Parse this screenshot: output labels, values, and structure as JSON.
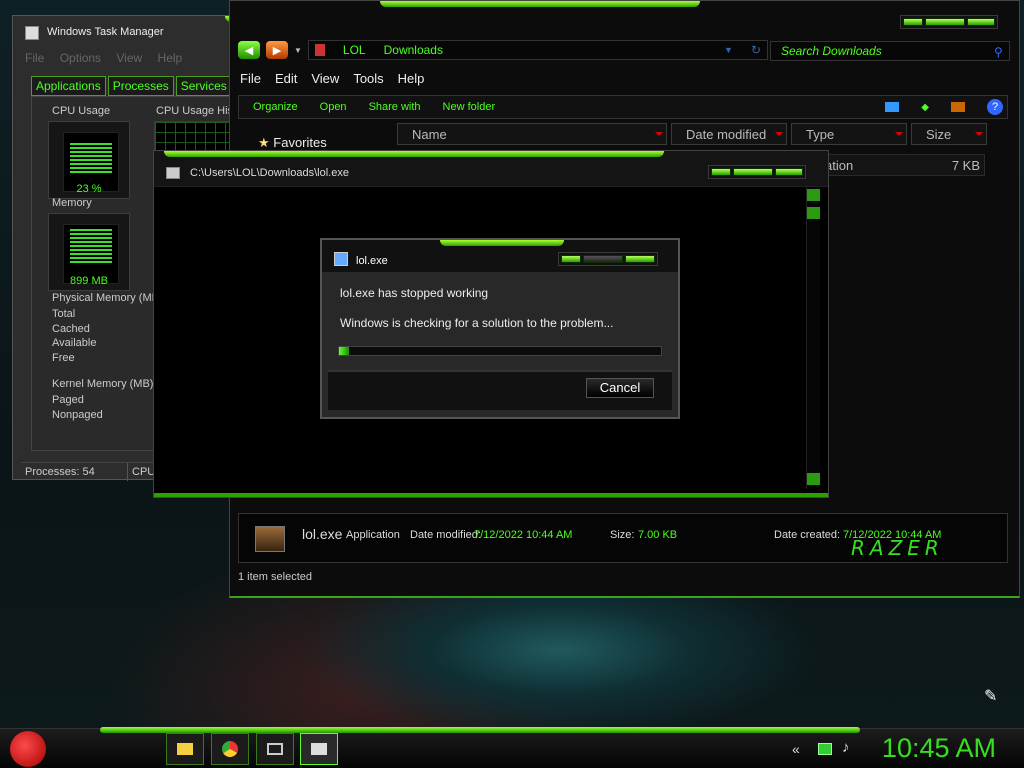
{
  "taskmanager": {
    "title": "Windows Task Manager",
    "menu": [
      "File",
      "Options",
      "View",
      "Help"
    ],
    "tabs": [
      "Applications",
      "Processes",
      "Services",
      "Pe"
    ],
    "cpu_usage_label": "CPU Usage",
    "cpu_history_label": "CPU Usage His",
    "cpu_value": "23 %",
    "memory_label": "Memory",
    "memory_value": "899 MB",
    "physical_label": "Physical Memory (MB",
    "physical_rows": [
      "Total",
      "Cached",
      "Available",
      "Free"
    ],
    "kernel_label": "Kernel Memory (MB)",
    "kernel_rows": [
      "Paged",
      "Nonpaged"
    ],
    "status_processes": "Processes: 54",
    "status_cpu": "CPU"
  },
  "explorer": {
    "breadcrumb": [
      "LOL",
      "Downloads"
    ],
    "search_placeholder": "Search Downloads",
    "menubar": [
      "File",
      "Edit",
      "View",
      "Tools",
      "Help"
    ],
    "toolbar": [
      "Organize",
      "Open",
      "Share with",
      "New folder"
    ],
    "columns": [
      "Name",
      "Date modified",
      "Type",
      "Size"
    ],
    "favorites": "Favorites",
    "row_type": "ation",
    "row_size": "7 KB",
    "details": {
      "name": "lol.exe",
      "type": "Application",
      "date_modified_label": "Date modified:",
      "date_modified": "7/12/2022 10:44 AM",
      "size_label": "Size:",
      "size": "7.00 KB",
      "date_created_label": "Date created:",
      "date_created": "7/12/2022 10:44 AM",
      "brand": "RAZER"
    },
    "selection_status": "1 item selected"
  },
  "host_window": {
    "path": "C:\\Users\\LOL\\Downloads\\lol.exe"
  },
  "error_dialog": {
    "title": "lol.exe",
    "message": "lol.exe has stopped working",
    "submessage": "Windows is checking for a solution to the problem...",
    "progress": 0.03,
    "cancel_label": "Cancel"
  },
  "taskbar": {
    "clock": "10:45 AM"
  },
  "colors": {
    "accent_green": "#4cff1f",
    "bar_green": "#2ea000"
  }
}
